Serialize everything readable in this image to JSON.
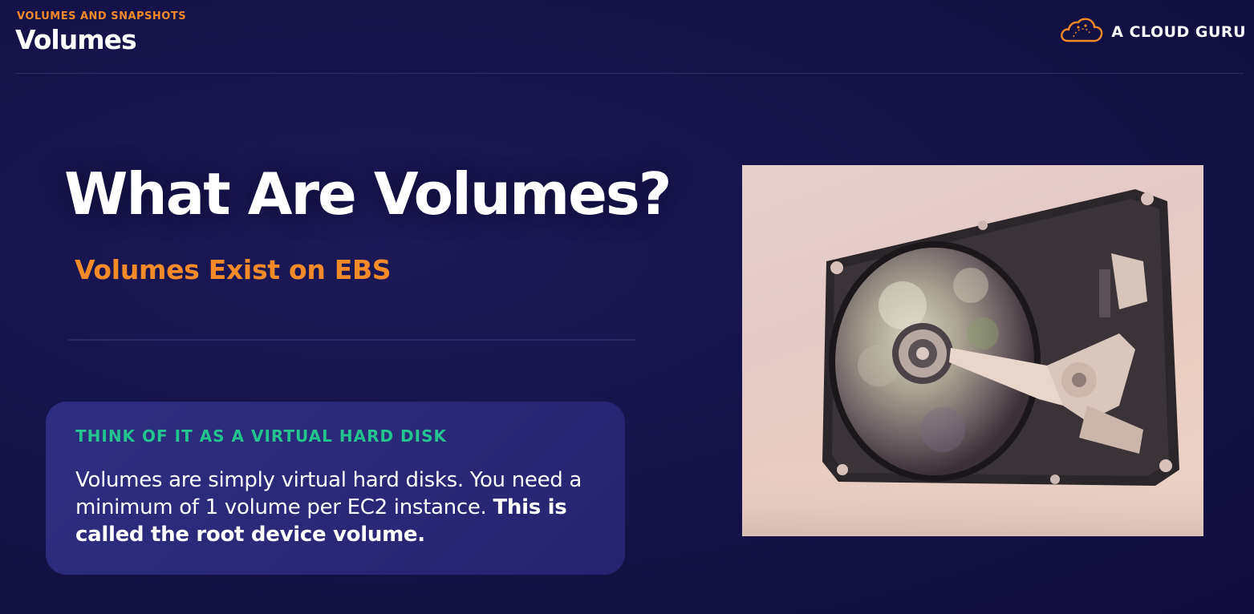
{
  "header": {
    "eyebrow": "VOLUMES AND SNAPSHOTS",
    "title": "Volumes"
  },
  "brand": {
    "name": "A CLOUD GURU",
    "icon": "cloud-logo-icon",
    "accent_color": "#f58a29"
  },
  "slide": {
    "title": "What Are Volumes?",
    "subtitle": "Volumes Exist on EBS"
  },
  "callout": {
    "heading": "THINK OF IT AS A VIRTUAL HARD DISK",
    "body_text": "Volumes are simply virtual hard disks. You need a minimum of 1 volume per EC2 instance.",
    "body_bold": "This is called the root device volume."
  },
  "image": {
    "subject": "hard-disk-drive-photo"
  },
  "colors": {
    "background": "#15134a",
    "accent_orange": "#f58a29",
    "accent_green": "#24c490",
    "callout_bg": "#2c2a7a"
  }
}
